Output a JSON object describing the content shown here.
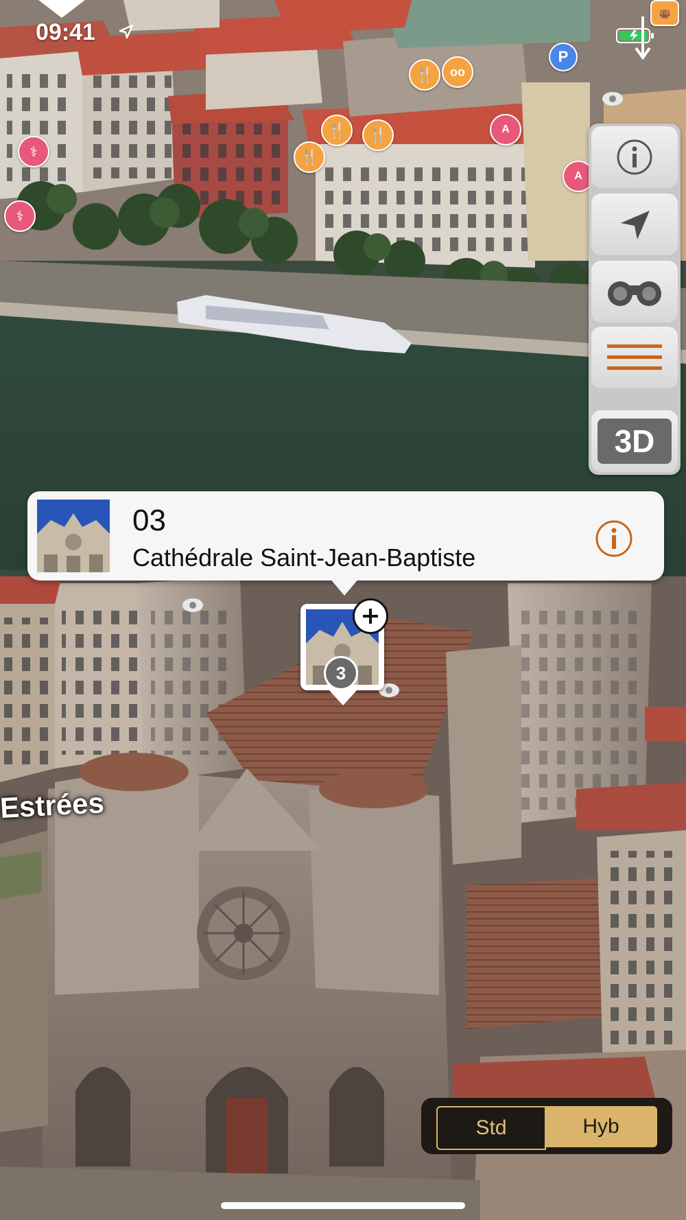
{
  "status": {
    "time": "09:41"
  },
  "map": {
    "street_label": "Estrées",
    "mode": "hybrid 3D satellite"
  },
  "callout": {
    "number": "03",
    "title": "Cathédrale Saint-Jean-Baptiste"
  },
  "marker": {
    "badge": "3"
  },
  "controls": {
    "three_d_label": "3D"
  },
  "segmented": {
    "std_label": "Std",
    "hyb_label": "Hyb",
    "selected": "Hyb"
  },
  "colors": {
    "accent_orange": "#c8661c",
    "segment_gold": "#d9b46a",
    "poi_restaurant": "#f5a340",
    "poi_medical": "#e8587a",
    "poi_parking": "#4a86e8"
  },
  "icons": [
    "location-arrow-icon",
    "info-icon",
    "navigation-arrow-icon",
    "binoculars-icon",
    "menu-icon",
    "restaurant-icon",
    "glasses-icon",
    "parking-icon",
    "medical-icon",
    "shopping-icon",
    "battery-icon",
    "add-icon"
  ]
}
